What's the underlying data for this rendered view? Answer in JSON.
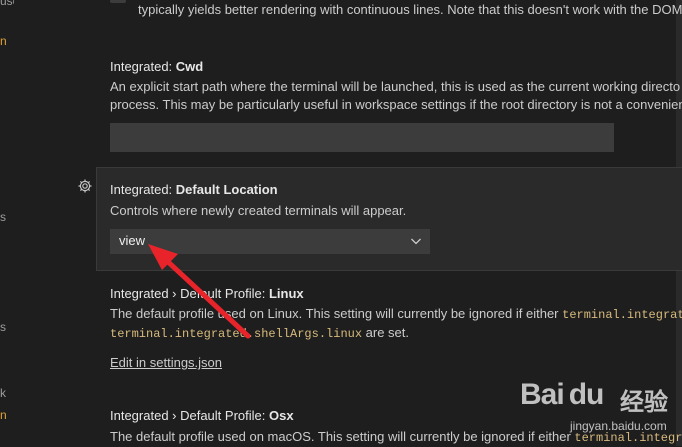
{
  "leftnav": {
    "fragments": [
      {
        "text": "used",
        "orange": false
      },
      {
        "text": "n",
        "orange": true
      },
      {
        "text": "s",
        "orange": false
      },
      {
        "text": "s",
        "orange": false
      },
      {
        "text": "k",
        "orange": false
      },
      {
        "text": "n",
        "orange": true
      }
    ]
  },
  "top_setting": {
    "desc": "typically yields better rendering with continuous lines. Note that this doesn't work with the DOM"
  },
  "cwd": {
    "category": "Integrated: ",
    "name": "Cwd",
    "desc_line1": "An explicit start path where the terminal will be launched, this is used as the current working directo",
    "desc_line2": "process. This may be particularly useful in workspace settings if the root directory is not a convenien",
    "value": ""
  },
  "default_location": {
    "category": "Integrated: ",
    "name": "Default Location",
    "desc": "Controls where newly created terminals will appear.",
    "selected": "view"
  },
  "profile_linux": {
    "category": "Integrated › Default Profile: ",
    "name": "Linux",
    "desc_prefix": "The default profile used on Linux. This setting will currently be ignored if either ",
    "code1": "terminal.integrat",
    "code2": "terminal.integrated.shellArgs.linux",
    "desc_suffix": " are set.",
    "link": "Edit in settings.json"
  },
  "profile_osx": {
    "category": "Integrated › Default Profile: ",
    "name": "Osx",
    "desc_prefix": "The default profile used on macOS. This setting will currently be ignored if either ",
    "code1": "terminal.integr"
  },
  "watermark": {
    "logo": "Bai du",
    "cn": "经验",
    "url": "jingyan.baidu.com"
  },
  "colors": {
    "background": "#1e1e1e",
    "focused_row": "#2a2a2a",
    "input": "#3c3c3c",
    "code": "#d7ba7d",
    "annotation_arrow": "#e8242a"
  },
  "icons": [
    "gear-icon",
    "chevron-down-icon",
    "annotation-arrow"
  ]
}
